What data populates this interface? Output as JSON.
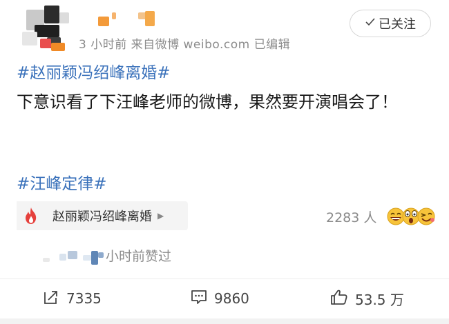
{
  "post": {
    "meta": "3 小时前  来自微博 weibo.com  已编辑",
    "follow_label": "已关注",
    "topic1": "#赵丽颖冯绍峰离婚#",
    "text": "下意识看了下汪峰老师的微博，果然要开演唱会了！",
    "topic2": "#汪峰定律#"
  },
  "topic_card": {
    "label": "赵丽颖冯绍峰离婚",
    "count": "2283 人"
  },
  "liked": {
    "text": "小时前赞过"
  },
  "actions": {
    "repost": "7335",
    "comment": "9860",
    "like": "53.5 万"
  },
  "colors": {
    "topic": "#3b72bb",
    "meta": "#8c8c8c",
    "fire": "#e5403c"
  },
  "icons": {
    "follow": "check-icon",
    "card": "fire-icon",
    "arrow": "triangle-right-icon",
    "repost": "repost-icon",
    "comment": "comment-icon",
    "like": "thumbs-up-icon"
  }
}
